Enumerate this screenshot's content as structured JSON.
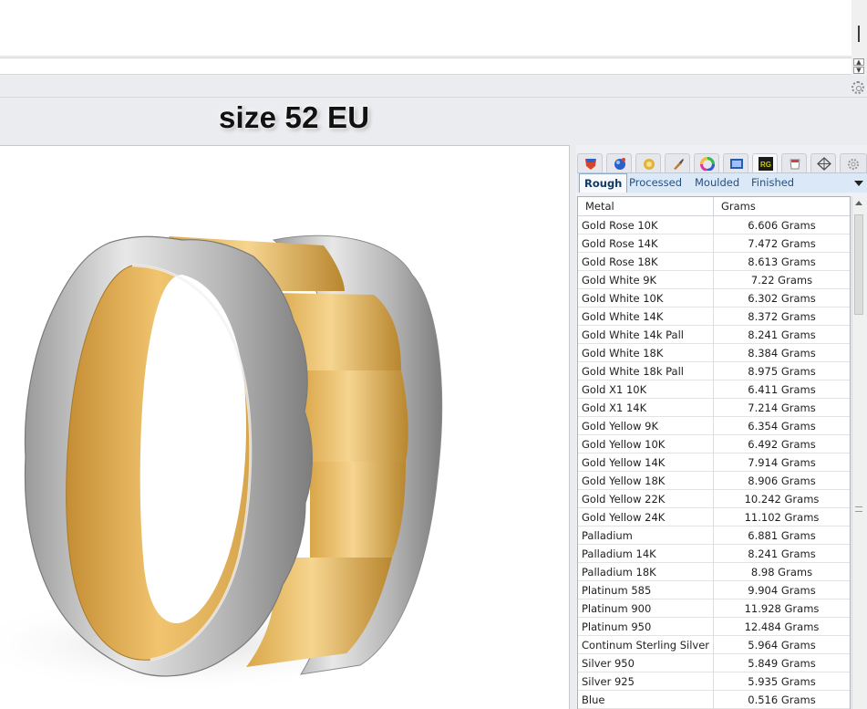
{
  "viewport_label": "size 52 EU",
  "panel": {
    "icon_tabs": [
      {
        "icon": "layers-shield-icon",
        "color": "#d9432a"
      },
      {
        "icon": "material-sphere-icon",
        "color": "#2a60c9"
      },
      {
        "icon": "gem-icon",
        "color": "#e0b43a"
      },
      {
        "icon": "paint-brush-icon",
        "color": "#c57a2a"
      },
      {
        "icon": "color-wheel-icon",
        "color": "#d63aa0"
      },
      {
        "icon": "render-window-icon",
        "color": "#2a5da8"
      },
      {
        "icon": "rg-logo-icon",
        "color": "#c7c718"
      },
      {
        "icon": "ring-weight-icon",
        "color": "#8a8a8a"
      },
      {
        "icon": "snap-target-icon",
        "color": "#505050"
      },
      {
        "icon": "settings-gear-icon",
        "color": "#9a9a9a"
      }
    ],
    "sub_tabs": [
      "Rough",
      "Processed",
      "Moulded",
      "Finished"
    ],
    "active_sub_tab": "Rough",
    "table": {
      "columns": [
        "Metal",
        "Grams"
      ],
      "rows": [
        {
          "metal": "Gold Rose 10K",
          "grams": "6.606 Grams"
        },
        {
          "metal": "Gold Rose 14K",
          "grams": "7.472 Grams"
        },
        {
          "metal": "Gold Rose 18K",
          "grams": "8.613 Grams"
        },
        {
          "metal": "Gold White 9K",
          "grams": "7.22 Grams"
        },
        {
          "metal": "Gold White 10K",
          "grams": "6.302 Grams"
        },
        {
          "metal": "Gold White 14K",
          "grams": "8.372 Grams"
        },
        {
          "metal": "Gold White 14k Pall",
          "grams": "8.241 Grams"
        },
        {
          "metal": "Gold White 18K",
          "grams": "8.384 Grams"
        },
        {
          "metal": "Gold White 18k Pall",
          "grams": "8.975 Grams"
        },
        {
          "metal": "Gold X1 10K",
          "grams": "6.411 Grams"
        },
        {
          "metal": "Gold X1 14K",
          "grams": "7.214 Grams"
        },
        {
          "metal": "Gold Yellow 9K",
          "grams": "6.354 Grams"
        },
        {
          "metal": "Gold Yellow 10K",
          "grams": "6.492 Grams"
        },
        {
          "metal": "Gold Yellow 14K",
          "grams": "7.914 Grams"
        },
        {
          "metal": "Gold Yellow 18K",
          "grams": "8.906 Grams"
        },
        {
          "metal": "Gold Yellow 22K",
          "grams": "10.242 Grams"
        },
        {
          "metal": "Gold Yellow 24K",
          "grams": "11.102 Grams"
        },
        {
          "metal": "Palladium",
          "grams": "6.881 Grams"
        },
        {
          "metal": "Palladium 14K",
          "grams": "8.241 Grams"
        },
        {
          "metal": "Palladium 18K",
          "grams": "8.98 Grams"
        },
        {
          "metal": "Platinum 585",
          "grams": "9.904 Grams"
        },
        {
          "metal": "Platinum 900",
          "grams": "11.928 Grams"
        },
        {
          "metal": "Platinum 950",
          "grams": "12.484 Grams"
        },
        {
          "metal": "Continum Sterling Silver",
          "grams": "5.964 Grams"
        },
        {
          "metal": "Silver 950",
          "grams": "5.849 Grams"
        },
        {
          "metal": "Silver 925",
          "grams": "5.935 Grams"
        },
        {
          "metal": "Blue",
          "grams": "0.516 Grams"
        }
      ]
    }
  },
  "colors": {
    "gold": "#e6b85a",
    "silver": "#c4c4c4",
    "tab_blue": "#dbe8f8"
  }
}
